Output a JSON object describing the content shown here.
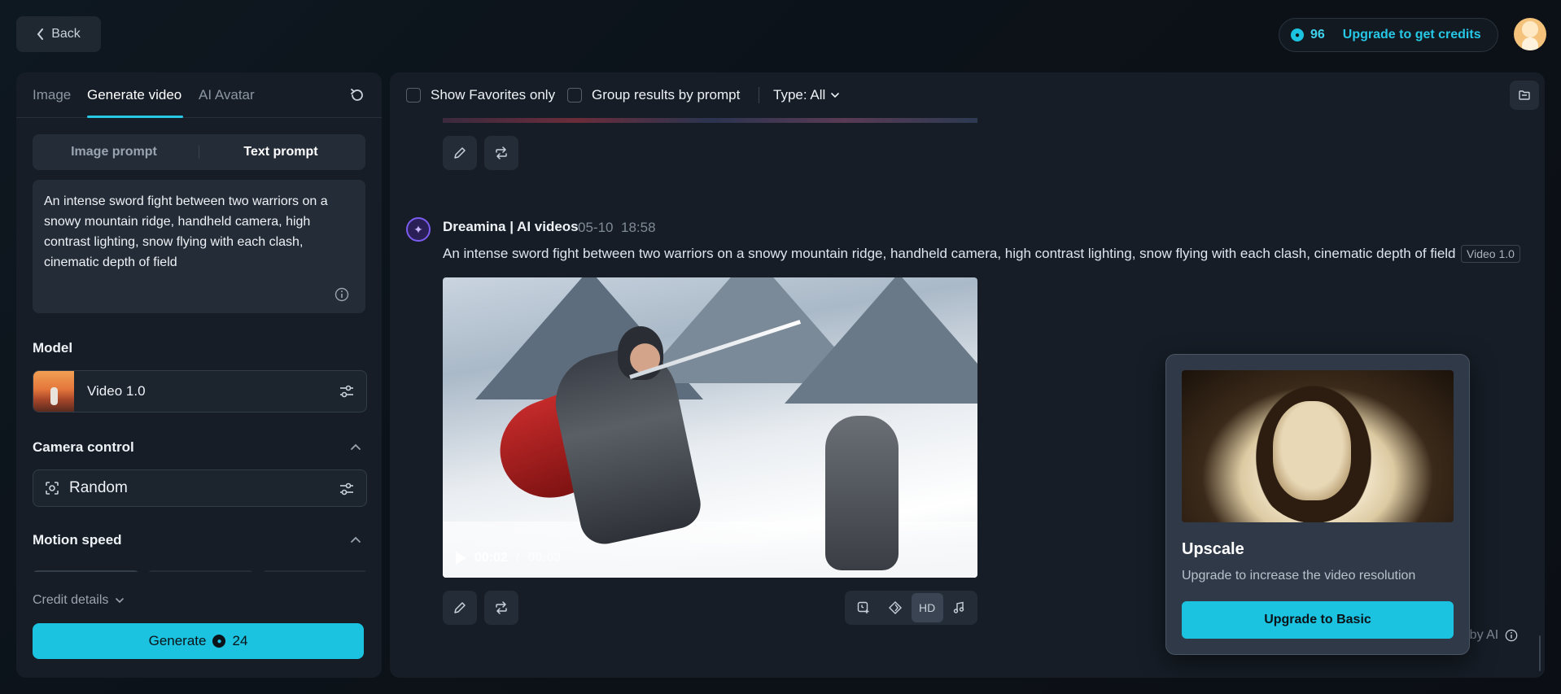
{
  "topbar": {
    "back_label": "Back",
    "credits": "96",
    "upgrade_label": "Upgrade to get credits"
  },
  "left": {
    "tabs": [
      {
        "label": "Image"
      },
      {
        "label": "Generate video"
      },
      {
        "label": "AI Avatar"
      }
    ],
    "active_tab": "Generate video",
    "prompt_modes": {
      "image": "Image prompt",
      "text": "Text prompt",
      "active": "Text prompt"
    },
    "prompt_text": "An intense sword fight between two warriors on a snowy mountain ridge, handheld camera, high contrast lighting, snow flying with each clash, cinematic depth of field",
    "model": {
      "title": "Model",
      "value": "Video 1.0"
    },
    "camera": {
      "title": "Camera control",
      "value": "Random"
    },
    "motion": {
      "title": "Motion speed"
    },
    "credit_details_label": "Credit details",
    "generate": {
      "label": "Generate",
      "cost": "24"
    }
  },
  "right": {
    "filters": {
      "show_favorites": "Show Favorites only",
      "group_results": "Group results by prompt",
      "type_label": "Type: All"
    },
    "result": {
      "name": "Dreamina | AI videos",
      "date": "05-10",
      "time": "18:58",
      "prompt": "An intense sword fight between two warriors on a snowy mountain ridge, handheld camera, high contrast lighting, snow flying with each clash, cinematic depth of field",
      "version": "Video 1.0",
      "video_current": "00:02",
      "video_separator": "/",
      "video_total": "00:03",
      "hd_label": "HD"
    },
    "popover": {
      "title": "Upscale",
      "description": "Upgrade to increase the video resolution",
      "button": "Upgrade to Basic"
    },
    "footer": "All content generated by AI"
  },
  "colors": {
    "accent": "#1bc3e0",
    "background": "#0b0f15",
    "panel": "#161d26"
  }
}
